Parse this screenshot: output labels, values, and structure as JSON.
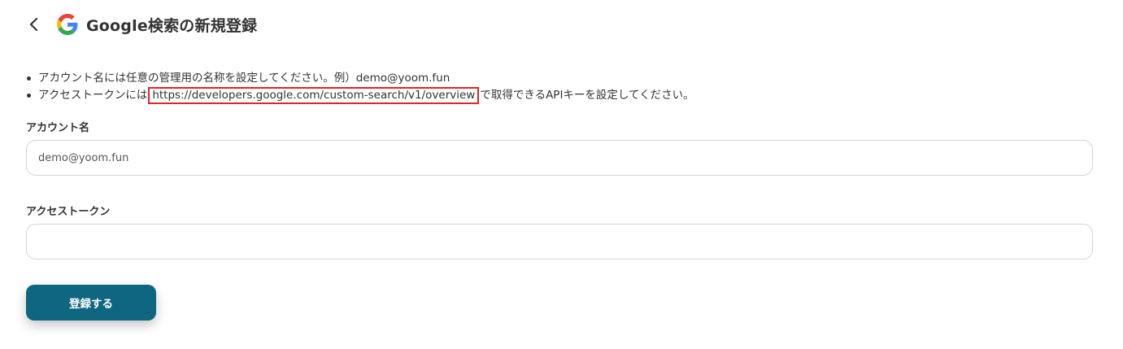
{
  "header": {
    "title": "Google検索の新規登録",
    "back_icon": "chevron-left-icon",
    "logo_icon": "google-g-logo"
  },
  "notes": {
    "item1": "アカウント名には任意の管理用の名称を設定してください。例）demo@yoom.fun",
    "item2_prefix": "アクセストークンには",
    "item2_link": "https://developers.google.com/custom-search/v1/overview",
    "item2_suffix": "で取得できるAPIキーを設定してください。"
  },
  "form": {
    "account_label": "アカウント名",
    "account_value": "demo@yoom.fun",
    "token_label": "アクセストークン",
    "token_value": ""
  },
  "submit_label": "登録する",
  "colors": {
    "primary": "#0e6680",
    "highlight": "#e0242a",
    "google_blue": "#4285F4",
    "google_red": "#EA4335",
    "google_yellow": "#FBBC05",
    "google_green": "#34A853"
  }
}
